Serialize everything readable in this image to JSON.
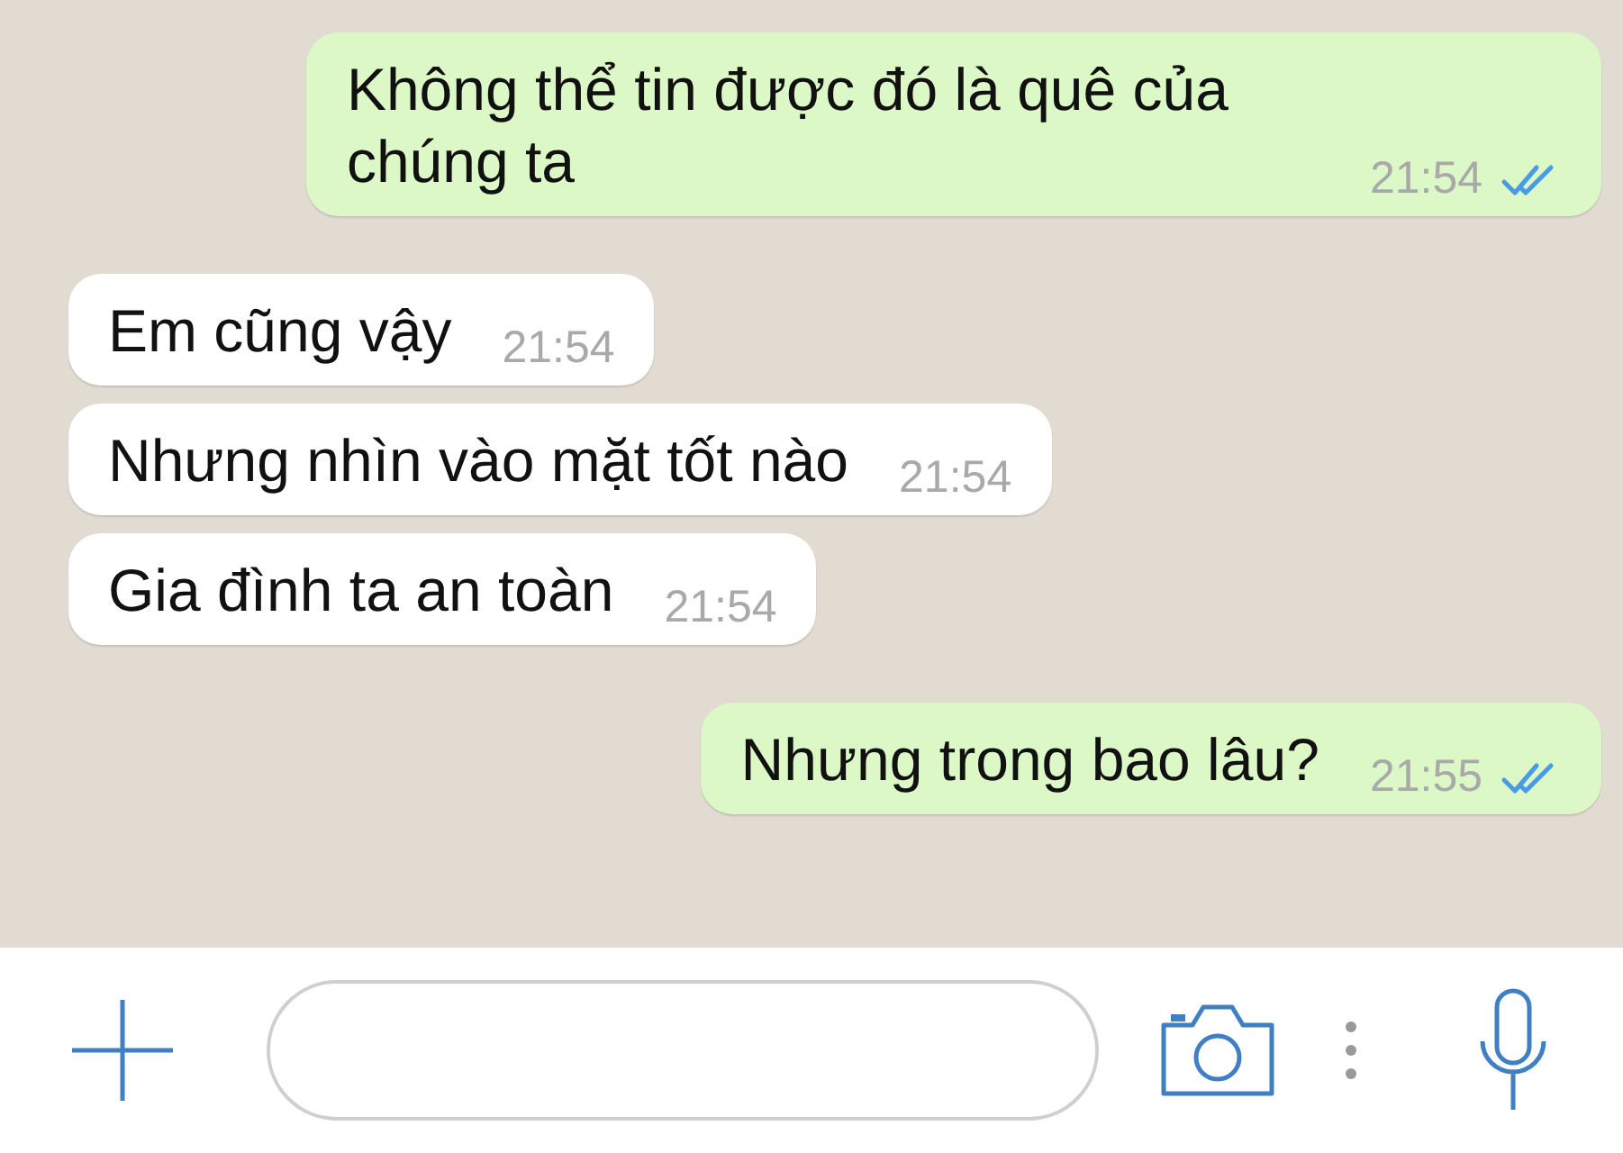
{
  "messages": [
    {
      "kind": "outgoing",
      "text": "Không thể tin được đó là quê của chúng ta",
      "time": "21:54",
      "read": true
    },
    {
      "kind": "incoming",
      "text": "Em cũng vậy",
      "time": "21:54"
    },
    {
      "kind": "incoming",
      "text": "Nhưng nhìn vào mặt tốt nào",
      "time": "21:54"
    },
    {
      "kind": "incoming",
      "text": "Gia đình ta an toàn",
      "time": "21:54"
    },
    {
      "kind": "outgoing",
      "text": "Nhưng trong bao lâu?",
      "time": "21:55",
      "read": true
    }
  ]
}
